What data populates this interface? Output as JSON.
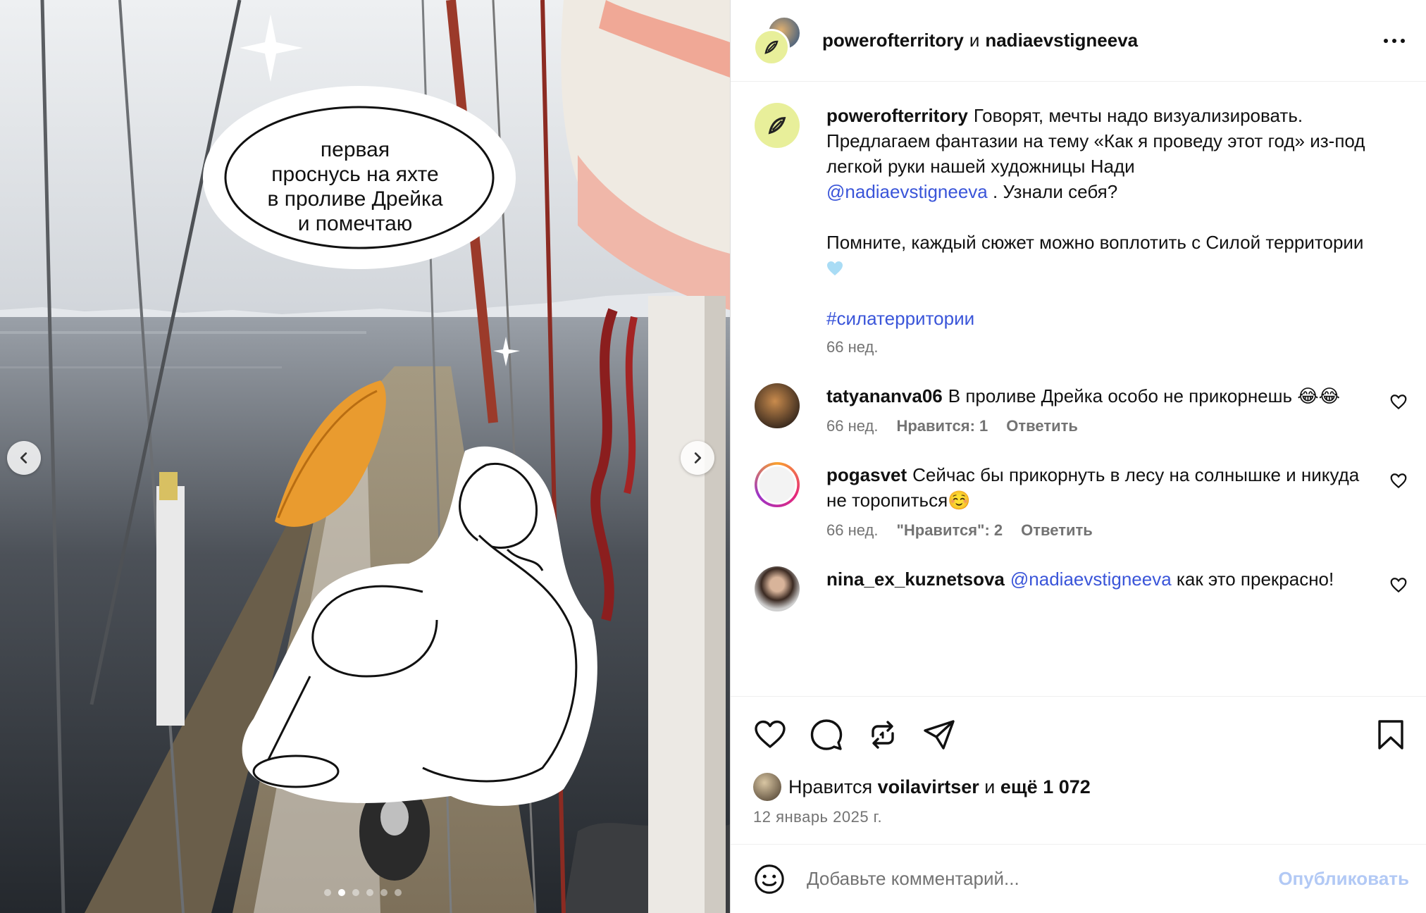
{
  "media": {
    "speech_bubble": "первая\nпроснусь на яхте\nв проливе Дрейка\nи помечтаю",
    "carousel": {
      "slide_count": 6,
      "active_index": 1
    },
    "prev_icon": "chevron-left-icon",
    "next_icon": "chevron-right-icon"
  },
  "header": {
    "user1": "powerofterritory",
    "joiner": "и",
    "user2": "nadiaevstigneeva",
    "more_icon": "more-horizontal-icon"
  },
  "caption": {
    "username": "powerofterritory",
    "text_part1": "Говорят, мечты надо визуализировать. Предлагаем фантазии на тему «Как я проведу этот год» из-под легкой руки нашей художницы Нади",
    "mention": "@nadiaevstigneeva",
    "text_part2": ". Узнали себя?",
    "paragraph2": "Помните, каждый сюжет можно воплотить с Силой территории",
    "paragraph2_emoji": "blue-heart-icon",
    "hashtag": "#силатерритории",
    "time": "66 нед."
  },
  "comments": [
    {
      "username": "tatyananva06",
      "text": "В проливе Дрейка особо не прикорнешь 😂😂",
      "time": "66 нед.",
      "likes": "Нравится: 1",
      "reply": "Ответить"
    },
    {
      "username": "pogasvet",
      "text": "Сейчас бы прикорнуть в лесу на солнышке и никуда не торопиться☺️",
      "time": "66 нед.",
      "likes": "\"Нравится\": 2",
      "reply": "Ответить"
    },
    {
      "username": "nina_ex_kuznetsova",
      "mention": "@nadiaevstigneeva",
      "text": "как это прекрасно!"
    }
  ],
  "actions": {
    "like_icon": "heart-icon",
    "comment_icon": "comment-icon",
    "repost_icon": "repost-icon",
    "share_icon": "send-icon",
    "save_icon": "bookmark-icon"
  },
  "likes": {
    "prefix": "Нравится",
    "user": "voilavirtser",
    "joiner": "и",
    "rest": "ещё 1 072"
  },
  "date": "12 январь 2025 г.",
  "comment_box": {
    "placeholder": "Добавьте комментарий...",
    "post_label": "Опубликовать",
    "emoji_icon": "smiley-icon"
  },
  "colors": {
    "link": "#3a55d9",
    "muted": "#737373",
    "post_disabled": "#b2c9f5",
    "brand_avatar": "#e8ef9a"
  }
}
